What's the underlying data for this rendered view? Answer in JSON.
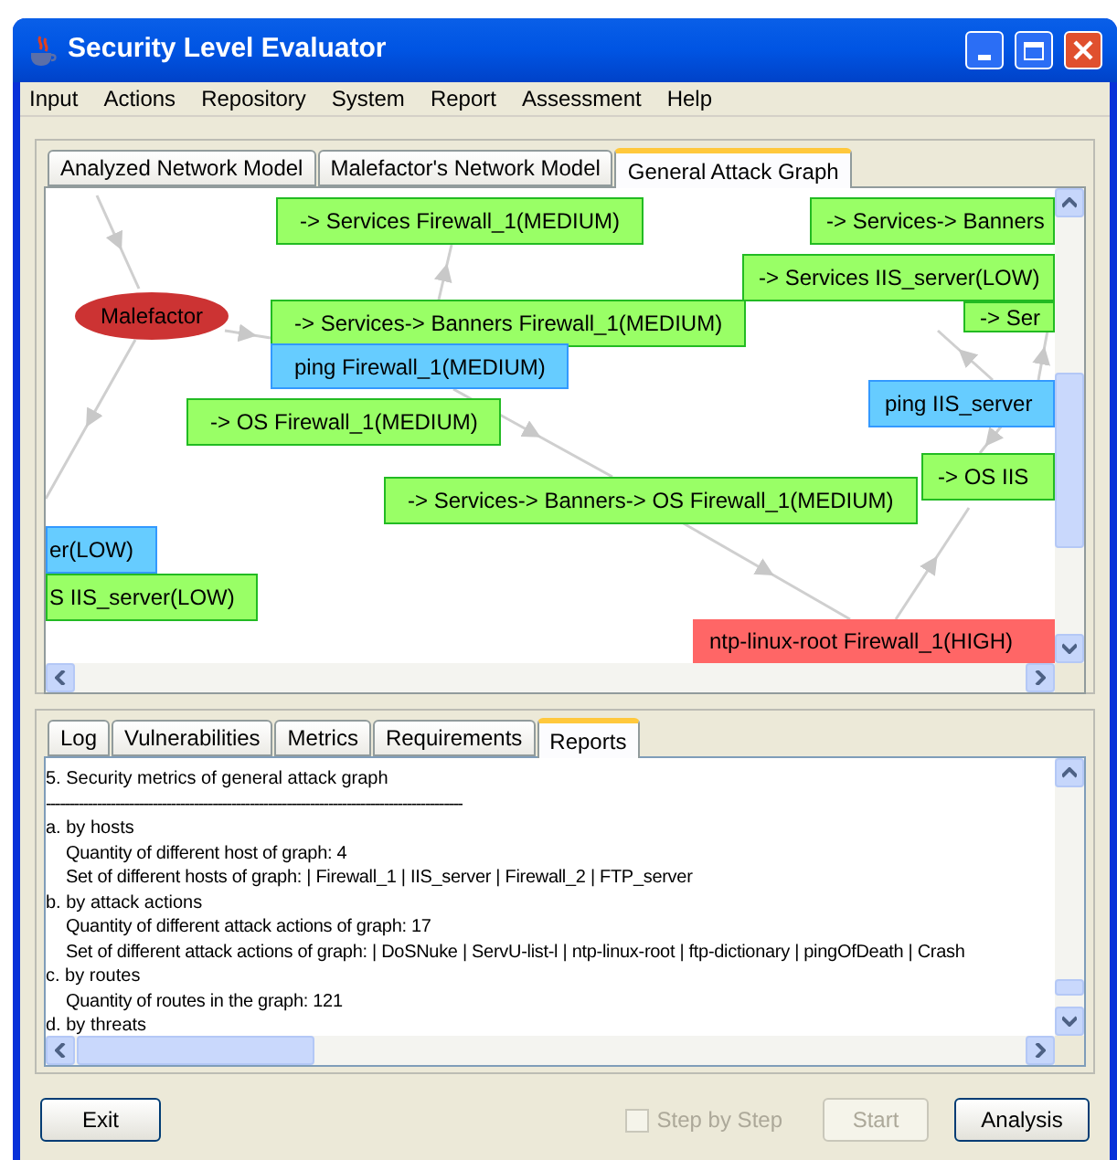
{
  "window": {
    "title": "Security Level Evaluator"
  },
  "menu": [
    "Input",
    "Actions",
    "Repository",
    "System",
    "Report",
    "Assessment",
    "Help"
  ],
  "top_tabs": [
    {
      "label": "Analyzed Network Model",
      "selected": false
    },
    {
      "label": "Malefactor's Network Model",
      "selected": false
    },
    {
      "label": "General Attack Graph",
      "selected": true
    }
  ],
  "graph": {
    "nodes": [
      {
        "kind": "action",
        "label": "-> Services Firewall_1(MEDIUM)",
        "color": "#99ff66"
      },
      {
        "kind": "action",
        "label": "-> Services-> Banners",
        "color": "#99ff66"
      },
      {
        "kind": "action",
        "label": "-> Services IIS_server(LOW)",
        "color": "#99ff66"
      },
      {
        "kind": "malefactor",
        "label": "Malefactor",
        "color": "#cc3333"
      },
      {
        "kind": "action",
        "label": "-> Services-> Banners Firewall_1(MEDIUM)",
        "color": "#99ff66"
      },
      {
        "kind": "action",
        "label": "-> Ser",
        "color": "#99ff66"
      },
      {
        "kind": "action",
        "label": "ping Firewall_1(MEDIUM)",
        "color": "#66ccff"
      },
      {
        "kind": "action",
        "label": "ping IIS_server",
        "color": "#66ccff"
      },
      {
        "kind": "action",
        "label": "-> OS Firewall_1(MEDIUM)",
        "color": "#99ff66"
      },
      {
        "kind": "action",
        "label": "-> OS IIS",
        "color": "#99ff66"
      },
      {
        "kind": "action",
        "label": "-> Services-> Banners-> OS Firewall_1(MEDIUM)",
        "color": "#99ff66"
      },
      {
        "kind": "action",
        "label": "er(LOW)",
        "color": "#66ccff"
      },
      {
        "kind": "action",
        "label": "S IIS_server(LOW)",
        "color": "#99ff66"
      },
      {
        "kind": "action",
        "label": "ntp-linux-root Firewall_1(HIGH)",
        "color": "#ff6666"
      }
    ]
  },
  "bottom_tabs": [
    {
      "label": "Log",
      "selected": false
    },
    {
      "label": "Vulnerabilities",
      "selected": false
    },
    {
      "label": "Metrics",
      "selected": false
    },
    {
      "label": "Requirements",
      "selected": false
    },
    {
      "label": "Reports",
      "selected": true
    }
  ],
  "report": {
    "title": "5. Security metrics of general attack graph",
    "rule": "------------------------------------------------------------------------------------------",
    "sections": [
      {
        "text": "a. by hosts",
        "children": [
          {
            "text": "Quantity of different host of graph: 4"
          },
          {
            "text": "Set of different hosts of graph:  | Firewall_1 | IIS_server | Firewall_2 | FTP_server"
          }
        ]
      },
      {
        "text": "b. by attack actions",
        "children": [
          {
            "text": "Quantity of different attack actions of graph: 17"
          },
          {
            "text": "Set of different attack actions of graph:  | DoSNuke | ServU-list-l | ntp-linux-root | ftp-dictionary | pingOfDeath | Crash"
          }
        ]
      },
      {
        "text": "c. by routes",
        "children": [
          {
            "text": "Quantity of routes in the graph: 121"
          }
        ]
      },
      {
        "text": "d. by threats"
      }
    ]
  },
  "step_by_step": {
    "label": "Step by Step",
    "checked": false,
    "disabled": true
  },
  "buttons": [
    {
      "label": "Exit",
      "disabled": false
    },
    {
      "label": "Start",
      "disabled": true
    },
    {
      "label": "Analysis",
      "disabled": false
    }
  ]
}
